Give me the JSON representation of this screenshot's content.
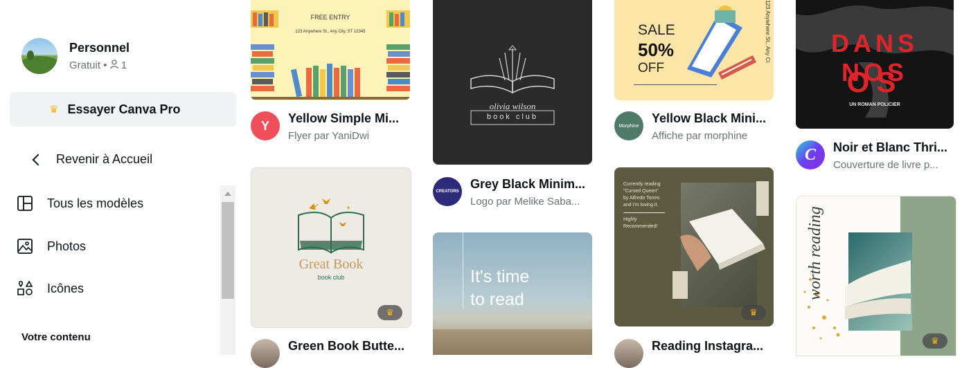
{
  "profile": {
    "name": "Personnel",
    "plan": "Gratuit",
    "members_count": "1"
  },
  "try_pro": {
    "label": "Essayer Canva Pro"
  },
  "back": {
    "label": "Revenir à Accueil"
  },
  "nav": [
    {
      "label": "Tous les modèles",
      "icon": "templates-icon"
    },
    {
      "label": "Photos",
      "icon": "photo-icon"
    },
    {
      "label": "Icônes",
      "icon": "shapes-icon"
    }
  ],
  "section_label": "Votre contenu",
  "cards": [
    {
      "title": "Yellow Simple Mi...",
      "subtitle": "Flyer par YaniDwi",
      "logo_text": "Y",
      "image_text": {
        "line1": "FREE ENTRY",
        "line2": "123 Anywhere St., Any City, ST 12345"
      }
    },
    {
      "title": "Grey Black Minim...",
      "subtitle": "Logo par Melike Saba...",
      "logo_text": "CREATORS",
      "image_text": {
        "line1": "olivia wilson",
        "line2": "book club"
      }
    },
    {
      "title": "Yellow Black Mini...",
      "subtitle": "Affiche par morphine",
      "logo_text": "Morphine",
      "image_text": {
        "line1": "SALE",
        "line2": "50%",
        "line3": "OFF",
        "side": "123 Anywhere St., Any Ci"
      }
    },
    {
      "title": "Noir et Blanc Thri...",
      "subtitle": "Couverture de livre p...",
      "logo_text": "C",
      "image_text": {
        "line1": "DANS NOS",
        "line2": "OS",
        "line3": "UN ROMAN POLICIER"
      }
    },
    {
      "title": "Green Book Butte...",
      "subtitle": "",
      "image_text": {
        "line1": "Great Book",
        "line2": "book club"
      }
    },
    {
      "title": "",
      "subtitle": "",
      "image_text": {
        "line1": "It's time",
        "line2": "to read"
      }
    },
    {
      "title": "Reading Instagra...",
      "subtitle": "",
      "image_text": {
        "line1": "Currently reading",
        "line2": "\"Cursed Queen\"",
        "line3": "by Alfredo Torres",
        "line4": "and I'm loving it.",
        "line5": "Highly",
        "line6": "Recommended!"
      }
    },
    {
      "title": "",
      "subtitle": "",
      "image_text": {
        "line1": "worth reading"
      }
    }
  ],
  "colors": {
    "accent_crown": "#f3b51b",
    "sidebar_highlight": "#f1f2f4"
  }
}
